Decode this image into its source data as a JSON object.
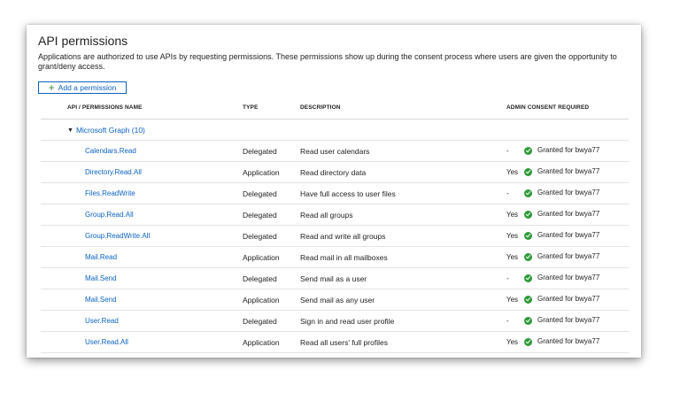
{
  "page": {
    "title": "API permissions",
    "description": "Applications are authorized to use APIs by requesting permissions. These permissions show up during the consent process where users are given the opportunity to grant/deny access.",
    "add_button_label": "Add a permission"
  },
  "table": {
    "headers": {
      "name": "API / PERMISSIONS NAME",
      "type": "TYPE",
      "description": "DESCRIPTION",
      "admin": "ADMIN CONSENT REQUIRED"
    },
    "group_label": "Microsoft Graph (10)",
    "rows": [
      {
        "name": "Calendars.Read",
        "type": "Delegated",
        "description": "Read user calendars",
        "admin": "-",
        "status": "Granted for bwya77"
      },
      {
        "name": "Directory.Read.All",
        "type": "Application",
        "description": "Read directory data",
        "admin": "Yes",
        "status": "Granted for bwya77"
      },
      {
        "name": "Files.ReadWrite",
        "type": "Delegated",
        "description": "Have full access to user files",
        "admin": "-",
        "status": "Granted for bwya77"
      },
      {
        "name": "Group.Read.All",
        "type": "Delegated",
        "description": "Read all groups",
        "admin": "Yes",
        "status": "Granted for bwya77"
      },
      {
        "name": "Group.ReadWrite.All",
        "type": "Delegated",
        "description": "Read and write all groups",
        "admin": "Yes",
        "status": "Granted for bwya77"
      },
      {
        "name": "Mail.Read",
        "type": "Application",
        "description": "Read mail in all mailboxes",
        "admin": "Yes",
        "status": "Granted for bwya77"
      },
      {
        "name": "Mail.Send",
        "type": "Delegated",
        "description": "Send mail as a user",
        "admin": "-",
        "status": "Granted for bwya77"
      },
      {
        "name": "Mail.Send",
        "type": "Application",
        "description": "Send mail as any user",
        "admin": "Yes",
        "status": "Granted for bwya77"
      },
      {
        "name": "User.Read",
        "type": "Delegated",
        "description": "Sign in and read user profile",
        "admin": "-",
        "status": "Granted for bwya77"
      },
      {
        "name": "User.Read.All",
        "type": "Application",
        "description": "Read all users' full profiles",
        "admin": "Yes",
        "status": "Granted for bwya77"
      }
    ]
  },
  "icons": {
    "add": "plus-icon",
    "expand": "triangle-down-icon",
    "granted": "green-check-circle-icon"
  },
  "colors": {
    "link": "#0b62c2",
    "granted": "#2e9a3a"
  }
}
